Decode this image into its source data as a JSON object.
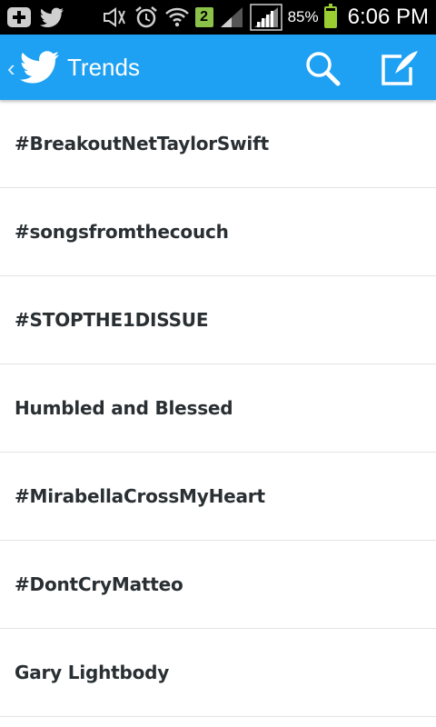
{
  "status_bar": {
    "signal_badge": "2",
    "battery_percent": "85%",
    "battery_level": 0.85,
    "time": "6:06 PM",
    "icons": [
      "add-icon",
      "twitter-notification-icon",
      "mute-icon",
      "alarm-icon",
      "wifi-icon",
      "sim-badge",
      "signal-bars-icon",
      "signal-bars-icon",
      "battery-icon"
    ]
  },
  "action_bar": {
    "title": "Trends",
    "background_color": "#1ea1f2",
    "icons": [
      "back-chevron-icon",
      "twitter-bird-icon",
      "search-icon",
      "compose-icon"
    ]
  },
  "trends": {
    "items": [
      {
        "label": "#BreakoutNetTaylorSwift"
      },
      {
        "label": "#songsfromthecouch"
      },
      {
        "label": "#STOPTHE1DISSUE"
      },
      {
        "label": "Humbled and Blessed"
      },
      {
        "label": "#MirabellaCrossMyHeart"
      },
      {
        "label": "#DontCryMatteo"
      },
      {
        "label": "Gary Lightbody"
      }
    ]
  }
}
